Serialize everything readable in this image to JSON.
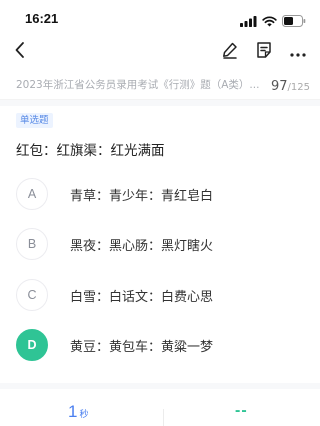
{
  "status_bar": {
    "time": "16:21",
    "icons": [
      "signal-icon",
      "wifi-icon",
      "battery-icon"
    ]
  },
  "nav": {
    "back_icon": "chevron-left-icon",
    "actions": [
      "edit-icon",
      "note-icon",
      "more-icon"
    ]
  },
  "exam": {
    "title": "2023年浙江省公务员录用考试《行测》题（A类）...",
    "progress_current": "97",
    "progress_total": "/125"
  },
  "question": {
    "type_tag": "单选题",
    "stem": "红包：红旗渠：红光满面",
    "options": [
      {
        "letter": "A",
        "text": "青草：青少年：青红皂白",
        "selected": false
      },
      {
        "letter": "B",
        "text": "黑夜：黑心肠：黑灯瞎火",
        "selected": false
      },
      {
        "letter": "C",
        "text": "白雪：白话文：白费心思",
        "selected": false
      },
      {
        "letter": "D",
        "text": "黄豆：黄包车：黄粱一梦",
        "selected": true
      }
    ]
  },
  "bottom": {
    "timer_value": "1",
    "timer_unit": "秒",
    "result": "--"
  },
  "colors": {
    "accent_blue": "#4a7ff0",
    "selected_green": "#2fc495",
    "tag_bg": "#ecf3ff"
  }
}
